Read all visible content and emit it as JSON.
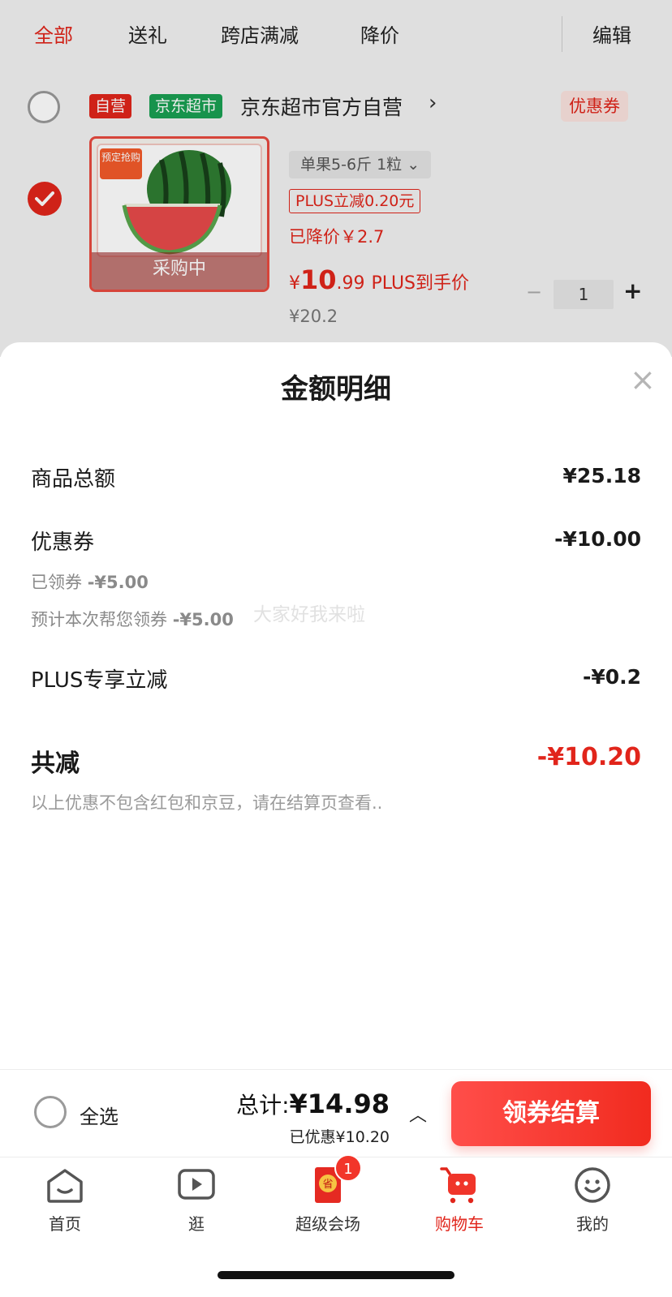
{
  "tabs": [
    {
      "label": "全部",
      "active": true
    },
    {
      "label": "送礼",
      "active": false
    },
    {
      "label": "跨店满减",
      "active": false
    },
    {
      "label": "降价",
      "active": false
    }
  ],
  "edit_label": "编辑",
  "store": {
    "badge_self": "自营",
    "badge_market": "京东超市",
    "name": "京东超市官方自营",
    "coupon_tag": "优惠券"
  },
  "product": {
    "promo_text": "预定抢购",
    "overlay_text": "采购中",
    "spec": "单果5-6斤 1粒",
    "plus_discount": "PLUS立减0.20元",
    "price_drop": "已降价￥2.7",
    "price_currency": "¥",
    "price_integer": "10",
    "price_decimal": ".99",
    "price_label": "PLUS到手价",
    "original_price": "¥20.2",
    "quantity": "1"
  },
  "sheet": {
    "title": "金额明细",
    "rows": [
      {
        "label": "商品总额",
        "value": "¥25.18"
      },
      {
        "label": "优惠券",
        "value": "-¥10.00"
      },
      {
        "label": "PLUS专享立减",
        "value": "-¥0.2"
      }
    ],
    "coupon_claimed": {
      "label": "已领券",
      "value": "-¥5.00"
    },
    "coupon_estimated": {
      "label": "预计本次帮您领券",
      "value": "-¥5.00"
    },
    "total_label": "共减",
    "total_value": "-¥10.20",
    "footnote": "以上优惠不包含红包和京豆，请在结算页查看..",
    "watermark": "大家好我来啦"
  },
  "checkout": {
    "select_all": "全选",
    "total_prefix": "总计:",
    "total_amount": "¥14.98",
    "saved": "已优惠¥10.20",
    "button": "领券结算"
  },
  "tabbar": [
    {
      "label": "首页",
      "icon": "home-icon"
    },
    {
      "label": "逛",
      "icon": "play-icon"
    },
    {
      "label": "超级会场",
      "icon": "super-venue-icon",
      "badge": "1"
    },
    {
      "label": "购物车",
      "icon": "cart-icon",
      "active": true
    },
    {
      "label": "我的",
      "icon": "profile-icon"
    }
  ],
  "colors": {
    "accent": "#e1251b",
    "market_green": "#1aa053",
    "self_red": "#e1251b"
  }
}
